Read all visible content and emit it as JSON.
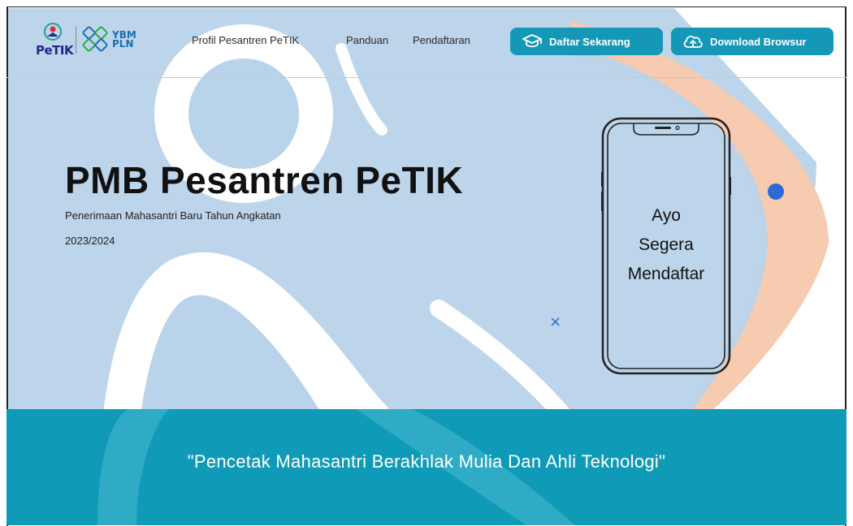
{
  "logo": {
    "brand": "PeTIK",
    "partner_line1": "YBM",
    "partner_line2": "PLN"
  },
  "nav": {
    "links": [
      "Profil Pesantren PeTIK",
      "Panduan",
      "Pendaftaran"
    ],
    "cta_register": "Daftar Sekarang",
    "cta_download": "Download Browsur"
  },
  "hero": {
    "title": "PMB Pesantren PeTIK",
    "subtitle": "Penerimaan Mahasantri Baru Tahun Angkatan",
    "year": "2023/2024"
  },
  "phone": {
    "line1": "Ayo",
    "line2": "Segera",
    "line3": "Mendaftar"
  },
  "decor": {
    "close_glyph": "×"
  },
  "banner": {
    "quote": "\"Pencetak Mahasantri Berakhlak Mulia Dan Ahli Teknologi\""
  },
  "colors": {
    "accent": "#1598b8",
    "banner": "#0f9bb8",
    "dot": "#2f69d6",
    "watermark_blue": "#b9d3ea",
    "watermark_orange": "#f6cbb0"
  },
  "icons": {
    "register": "graduation-cap-icon",
    "download": "cloud-upload-icon"
  }
}
